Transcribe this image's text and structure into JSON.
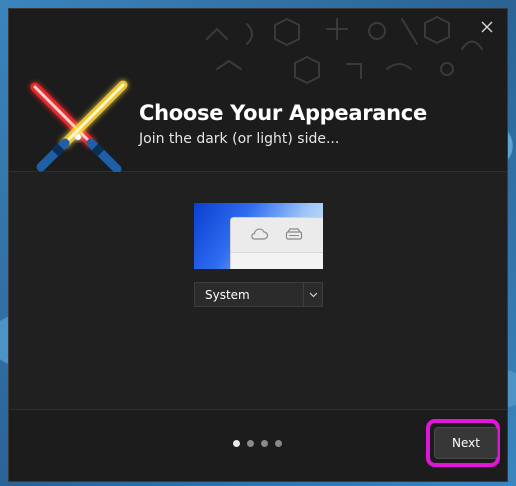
{
  "dialog": {
    "title": "Choose Your Appearance",
    "subtitle": "Join the dark (or light) side...",
    "close_icon": "close-icon",
    "logo_icon": "crossed-lightsabers-icon"
  },
  "theme": {
    "selected": "System",
    "preview_icons": [
      "cloud-icon",
      "drive-icon"
    ]
  },
  "pager": {
    "total_pages": 4,
    "current_page": 1
  },
  "footer": {
    "next_label": "Next"
  },
  "colors": {
    "accent_highlight": "#e016d8",
    "saber_red": "#ff3b3b",
    "saber_yellow": "#ffe04a"
  }
}
